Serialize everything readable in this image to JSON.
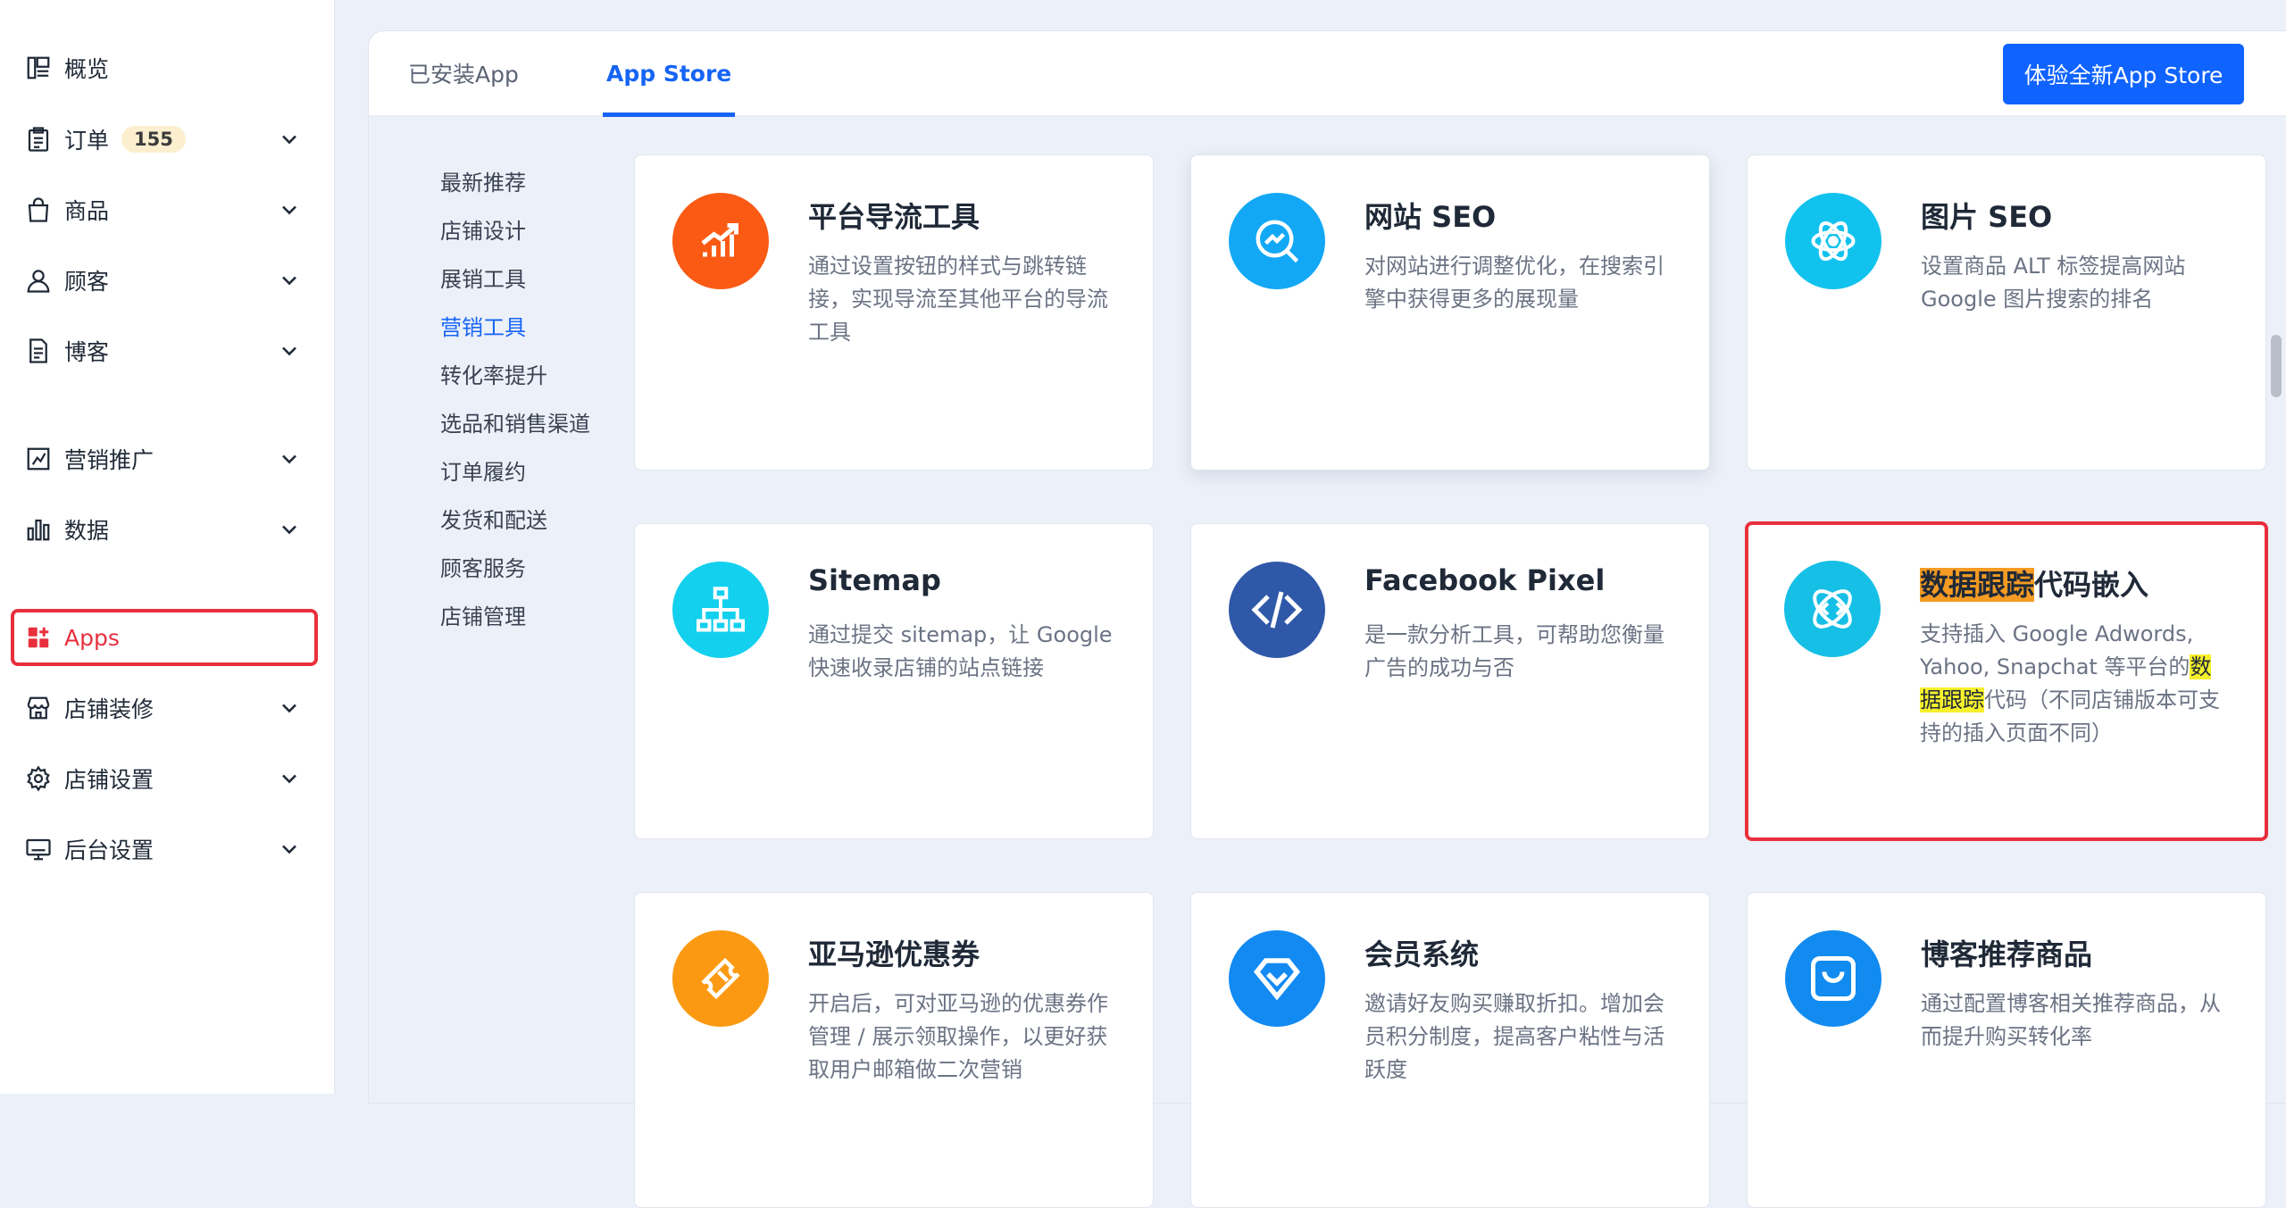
{
  "sidebar": {
    "items": [
      {
        "label": "概览",
        "icon": "dashboard-icon",
        "expandable": false
      },
      {
        "label": "订单",
        "icon": "clipboard-icon",
        "badge": "155",
        "expandable": true
      },
      {
        "label": "商品",
        "icon": "shopping-bag-icon",
        "expandable": true
      },
      {
        "label": "顾客",
        "icon": "user-icon",
        "expandable": true
      },
      {
        "label": "博客",
        "icon": "document-icon",
        "expandable": true
      },
      {
        "label": "营销推广",
        "icon": "marketing-icon",
        "expandable": true
      },
      {
        "label": "数据",
        "icon": "bar-chart-icon",
        "expandable": true
      },
      {
        "label": "Apps",
        "icon": "apps-icon",
        "expandable": false,
        "active": true
      },
      {
        "label": "店铺装修",
        "icon": "storefront-icon",
        "expandable": true
      },
      {
        "label": "店铺设置",
        "icon": "gear-icon",
        "expandable": true
      },
      {
        "label": "后台设置",
        "icon": "monitor-icon",
        "expandable": true
      }
    ]
  },
  "tabs": [
    {
      "label": "已安装App",
      "active": false
    },
    {
      "label": "App Store",
      "active": true
    }
  ],
  "header": {
    "new_store_button": "体验全新App Store"
  },
  "categories": [
    {
      "label": "最新推荐",
      "active": false
    },
    {
      "label": "店铺设计",
      "active": false
    },
    {
      "label": "展销工具",
      "active": false
    },
    {
      "label": "营销工具",
      "active": true
    },
    {
      "label": "转化率提升",
      "active": false
    },
    {
      "label": "选品和销售渠道",
      "active": false
    },
    {
      "label": "订单履约",
      "active": false
    },
    {
      "label": "发货和配送",
      "active": false
    },
    {
      "label": "顾客服务",
      "active": false
    },
    {
      "label": "店铺管理",
      "active": false
    }
  ],
  "apps": [
    {
      "title": "平台导流工具",
      "desc": "通过设置按钮的样式与跳转链接，实现导流至其他平台的导流工具",
      "icon": "growth-chart-icon",
      "color": "#fa5a14"
    },
    {
      "title": "网站 SEO",
      "desc": "对网站进行调整优化，在搜索引擎中获得更多的展现量",
      "icon": "seo-search-icon",
      "color": "#12a8f5"
    },
    {
      "title": "图片 SEO",
      "desc": "设置商品 ALT 标签提高网站 Google 图片搜索的排名",
      "icon": "atom-icon",
      "color": "#12c2ee"
    },
    {
      "title": "Sitemap",
      "desc": "通过提交 sitemap，让 Google 快速收录店铺的站点链接",
      "icon": "sitemap-icon",
      "color": "#13d0ee"
    },
    {
      "title": "Facebook Pixel",
      "desc": "是一款分析工具，可帮助您衡量广告的成功与否",
      "icon": "code-icon",
      "color": "#2f58a8"
    },
    {
      "title_hl": "数据跟踪",
      "title_rest": "代码嵌入",
      "desc_pre": "支持插入 Google Adwords, Yahoo, Snapchat 等平台的",
      "desc_hl": "数据跟踪",
      "desc_post": "代码（不同店铺版本可支持的插入页面不同）",
      "icon": "code-orbit-icon",
      "color": "#15bfe6"
    },
    {
      "title": "亚马逊优惠券",
      "desc": "开启后，可对亚马逊的优惠券作管理 / 展示领取操作，以更好获取用户邮箱做二次营销",
      "icon": "ticket-icon",
      "color": "#fb9a12"
    },
    {
      "title": "会员系统",
      "desc": "邀请好友购买赚取折扣。增加会员积分制度，提高客户粘性与活跃度",
      "icon": "diamond-icon",
      "color": "#138af2"
    },
    {
      "title": "博客推荐商品",
      "desc": "通过配置博客相关推荐商品，从而提升购买转化率",
      "icon": "shopping-bag-icon",
      "color": "#118bf0"
    }
  ]
}
